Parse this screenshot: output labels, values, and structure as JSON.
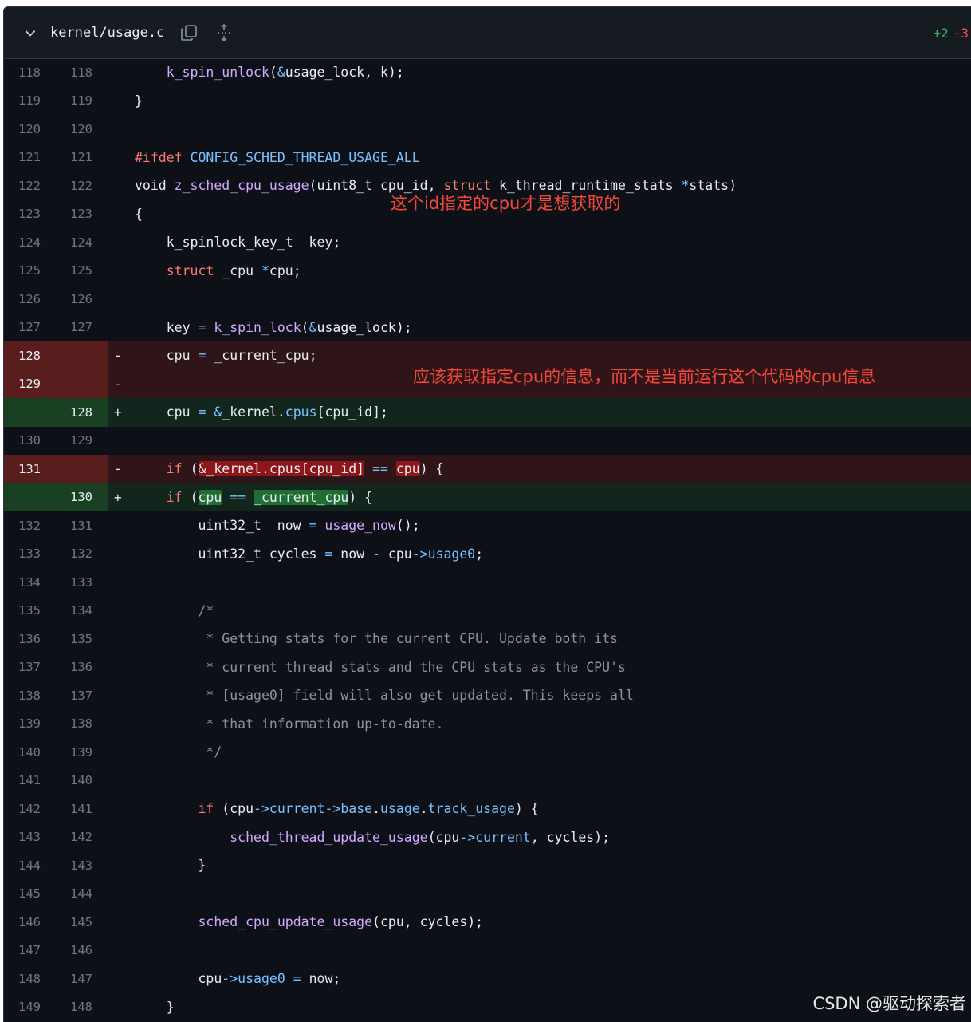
{
  "header": {
    "filename": "kernel/usage.c",
    "additions": "+2",
    "deletions": "-3"
  },
  "rows": [
    {
      "type": "ctx",
      "old": "118",
      "new": "118",
      "marker": "",
      "code": [
        [
          "    ",
          ""
        ],
        [
          "k_spin_unlock",
          "fn"
        ],
        [
          "(",
          ""
        ],
        [
          "&",
          "op"
        ],
        [
          "usage_lock, k);",
          ""
        ]
      ]
    },
    {
      "type": "ctx",
      "old": "119",
      "new": "119",
      "marker": "",
      "code": [
        [
          "}",
          ""
        ]
      ]
    },
    {
      "type": "ctx",
      "old": "120",
      "new": "120",
      "marker": "",
      "code": []
    },
    {
      "type": "ctx",
      "old": "121",
      "new": "121",
      "marker": "",
      "code": [
        [
          "#ifdef ",
          "kw"
        ],
        [
          "CONFIG_SCHED_THREAD_USAGE_ALL",
          "mac"
        ]
      ]
    },
    {
      "type": "ctx",
      "old": "122",
      "new": "122",
      "marker": "",
      "code": [
        [
          "void ",
          ""
        ],
        [
          "z_sched_cpu_usage",
          "fn"
        ],
        [
          "(uint8_t cpu_id, ",
          ""
        ],
        [
          "struct ",
          "kw"
        ],
        [
          "k_thread_runtime_stats ",
          ""
        ],
        [
          "*",
          "op"
        ],
        [
          "stats)",
          ""
        ]
      ]
    },
    {
      "type": "ctx",
      "old": "123",
      "new": "123",
      "marker": "",
      "code": [
        [
          "{",
          ""
        ]
      ]
    },
    {
      "type": "ctx",
      "old": "124",
      "new": "124",
      "marker": "",
      "code": [
        [
          "    k_spinlock_key_t  key;",
          ""
        ]
      ]
    },
    {
      "type": "ctx",
      "old": "125",
      "new": "125",
      "marker": "",
      "code": [
        [
          "    ",
          ""
        ],
        [
          "struct ",
          "kw"
        ],
        [
          "_cpu ",
          ""
        ],
        [
          "*",
          "op"
        ],
        [
          "cpu;",
          ""
        ]
      ]
    },
    {
      "type": "ctx",
      "old": "126",
      "new": "126",
      "marker": "",
      "code": []
    },
    {
      "type": "ctx",
      "old": "127",
      "new": "127",
      "marker": "",
      "code": [
        [
          "    key ",
          ""
        ],
        [
          "= ",
          "op"
        ],
        [
          "k_spin_lock",
          "fn"
        ],
        [
          "(",
          ""
        ],
        [
          "&",
          "op"
        ],
        [
          "usage_lock);",
          ""
        ]
      ]
    },
    {
      "type": "removed",
      "old": "128",
      "new": "",
      "marker": "-",
      "code": [
        [
          "    cpu ",
          ""
        ],
        [
          "= ",
          "op"
        ],
        [
          "_current_cpu;",
          ""
        ]
      ]
    },
    {
      "type": "removed",
      "old": "129",
      "new": "",
      "marker": "-",
      "code": []
    },
    {
      "type": "added",
      "old": "",
      "new": "128",
      "marker": "+",
      "code": [
        [
          "    cpu ",
          ""
        ],
        [
          "= ",
          "op"
        ],
        [
          "&",
          "op"
        ],
        [
          "_kernel.",
          ""
        ],
        [
          "cpus",
          "fld"
        ],
        [
          "[cpu_id];",
          ""
        ]
      ]
    },
    {
      "type": "ctx",
      "old": "130",
      "new": "129",
      "marker": "",
      "code": []
    },
    {
      "type": "removed",
      "old": "131",
      "new": "",
      "marker": "-",
      "code": [
        [
          "    ",
          ""
        ],
        [
          "if ",
          "kw"
        ],
        [
          "(",
          ""
        ],
        [
          "&_kernel.cpus[cpu_id]",
          "hl-del"
        ],
        [
          " ",
          ""
        ],
        [
          "==",
          "op"
        ],
        [
          " ",
          ""
        ],
        [
          "cpu",
          "hl-del"
        ],
        [
          ") {",
          ""
        ]
      ]
    },
    {
      "type": "added",
      "old": "",
      "new": "130",
      "marker": "+",
      "code": [
        [
          "    ",
          ""
        ],
        [
          "if ",
          "kw"
        ],
        [
          "(",
          ""
        ],
        [
          "cpu",
          "hl-add"
        ],
        [
          " ",
          ""
        ],
        [
          "==",
          "op"
        ],
        [
          " ",
          ""
        ],
        [
          "_current_cpu",
          "hl-add"
        ],
        [
          ") {",
          ""
        ]
      ]
    },
    {
      "type": "ctx",
      "old": "132",
      "new": "131",
      "marker": "",
      "code": [
        [
          "        uint32_t  now ",
          ""
        ],
        [
          "= ",
          "op"
        ],
        [
          "usage_now",
          "fn"
        ],
        [
          "();",
          ""
        ]
      ]
    },
    {
      "type": "ctx",
      "old": "133",
      "new": "132",
      "marker": "",
      "code": [
        [
          "        uint32_t cycles ",
          ""
        ],
        [
          "= ",
          "op"
        ],
        [
          "now ",
          ""
        ],
        [
          "- ",
          "op"
        ],
        [
          "cpu",
          ""
        ],
        [
          "->",
          "op"
        ],
        [
          "usage0",
          "fld"
        ],
        [
          ";",
          ""
        ]
      ]
    },
    {
      "type": "ctx",
      "old": "134",
      "new": "133",
      "marker": "",
      "code": []
    },
    {
      "type": "ctx",
      "old": "135",
      "new": "134",
      "marker": "",
      "code": [
        [
          "        /*",
          "cm"
        ]
      ]
    },
    {
      "type": "ctx",
      "old": "136",
      "new": "135",
      "marker": "",
      "code": [
        [
          "         * Getting stats for the current CPU. Update both its",
          "cm"
        ]
      ]
    },
    {
      "type": "ctx",
      "old": "137",
      "new": "136",
      "marker": "",
      "code": [
        [
          "         * current thread stats and the CPU stats as the CPU's",
          "cm"
        ]
      ]
    },
    {
      "type": "ctx",
      "old": "138",
      "new": "137",
      "marker": "",
      "code": [
        [
          "         * [usage0] field will also get updated. This keeps all",
          "cm"
        ]
      ]
    },
    {
      "type": "ctx",
      "old": "139",
      "new": "138",
      "marker": "",
      "code": [
        [
          "         * that information up-to-date.",
          "cm"
        ]
      ]
    },
    {
      "type": "ctx",
      "old": "140",
      "new": "139",
      "marker": "",
      "code": [
        [
          "         */",
          "cm"
        ]
      ]
    },
    {
      "type": "ctx",
      "old": "141",
      "new": "140",
      "marker": "",
      "code": []
    },
    {
      "type": "ctx",
      "old": "142",
      "new": "141",
      "marker": "",
      "code": [
        [
          "        ",
          ""
        ],
        [
          "if ",
          "kw"
        ],
        [
          "(cpu",
          ""
        ],
        [
          "->",
          "op"
        ],
        [
          "current",
          "fld"
        ],
        [
          "->",
          "op"
        ],
        [
          "base",
          "fld"
        ],
        [
          ".",
          ""
        ],
        [
          "usage",
          "fld"
        ],
        [
          ".",
          ""
        ],
        [
          "track_usage",
          "fld"
        ],
        [
          ") {",
          ""
        ]
      ]
    },
    {
      "type": "ctx",
      "old": "143",
      "new": "142",
      "marker": "",
      "code": [
        [
          "            ",
          ""
        ],
        [
          "sched_thread_update_usage",
          "fn"
        ],
        [
          "(cpu",
          ""
        ],
        [
          "->",
          "op"
        ],
        [
          "current",
          "fld"
        ],
        [
          ", cycles);",
          ""
        ]
      ]
    },
    {
      "type": "ctx",
      "old": "144",
      "new": "143",
      "marker": "",
      "code": [
        [
          "        }",
          ""
        ]
      ]
    },
    {
      "type": "ctx",
      "old": "145",
      "new": "144",
      "marker": "",
      "code": []
    },
    {
      "type": "ctx",
      "old": "146",
      "new": "145",
      "marker": "",
      "code": [
        [
          "        ",
          ""
        ],
        [
          "sched_cpu_update_usage",
          "fn"
        ],
        [
          "(cpu, cycles);",
          ""
        ]
      ]
    },
    {
      "type": "ctx",
      "old": "147",
      "new": "146",
      "marker": "",
      "code": []
    },
    {
      "type": "ctx",
      "old": "148",
      "new": "147",
      "marker": "",
      "code": [
        [
          "        cpu",
          ""
        ],
        [
          "->",
          "op"
        ],
        [
          "usage0",
          "fld"
        ],
        [
          " ",
          ""
        ],
        [
          "=",
          "op"
        ],
        [
          " now;",
          ""
        ]
      ]
    },
    {
      "type": "ctx",
      "old": "149",
      "new": "148",
      "marker": "",
      "code": [
        [
          "    }",
          ""
        ]
      ]
    }
  ],
  "annotations": {
    "note1": "这个id指定的cpu才是想获取的",
    "note2": "应该获取指定cpu的信息，而不是当前运行这个代码的cpu信息"
  },
  "watermark": "CSDN @驱动探索者",
  "icons": {
    "collapse": "chevron-down-icon",
    "copy": "copy-icon",
    "expand": "unfold-icon"
  }
}
